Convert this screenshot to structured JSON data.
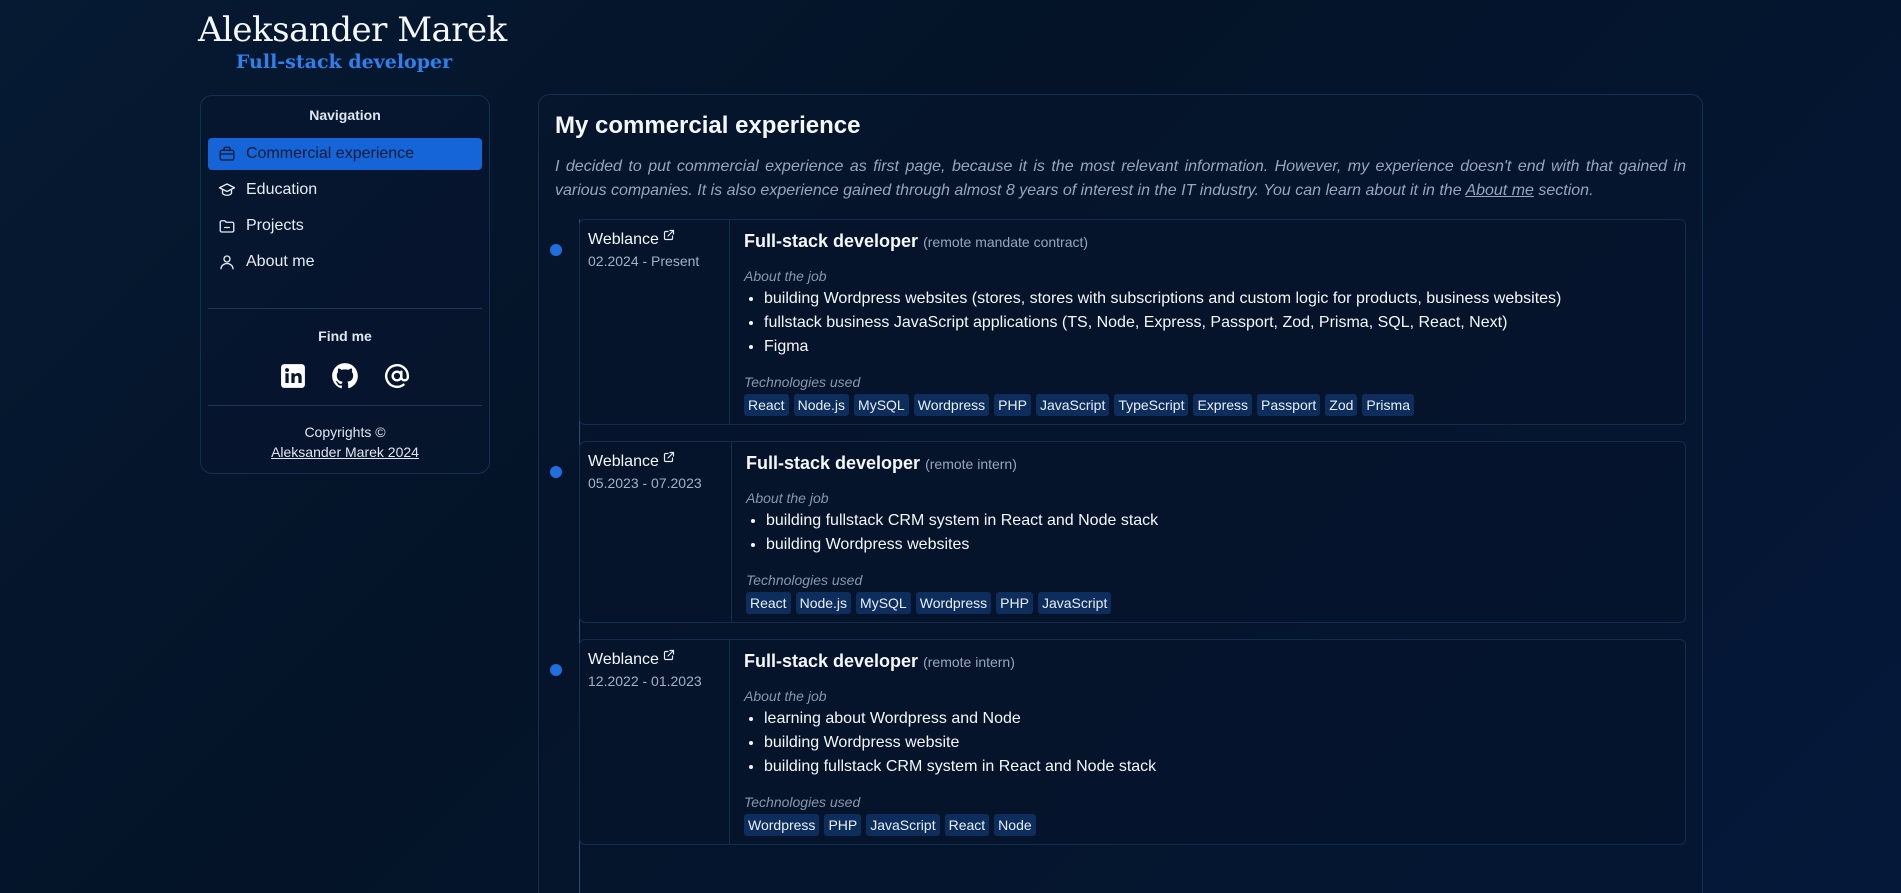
{
  "header": {
    "name": "Aleksander Marek",
    "role": "Full-stack developer"
  },
  "sidebar": {
    "nav_heading": "Navigation",
    "items": [
      {
        "label": "Commercial experience",
        "icon": "briefcase-icon",
        "active": true
      },
      {
        "label": "Education",
        "icon": "graduation-cap-icon",
        "active": false
      },
      {
        "label": "Projects",
        "icon": "folder-open-icon",
        "active": false
      },
      {
        "label": "About me",
        "icon": "user-icon",
        "active": false
      }
    ],
    "find_heading": "Find me",
    "social": [
      "linkedin-icon",
      "github-icon",
      "at-sign-icon"
    ],
    "copyright_line": "Copyrights ©",
    "copyright_link": "Aleksander Marek 2024"
  },
  "main": {
    "title": "My commercial experience",
    "intro_text": "I decided to put commercial experience as first page, because it is the most relevant information. However, my experience doesn't end with that gained in various companies. It is also experience gained through almost 8 years of interest in the IT industry. You can learn about it in the ",
    "intro_link": "About me",
    "intro_end": " section.",
    "about_label": "About the job",
    "tech_label": "Technologies used",
    "entries": [
      {
        "company": "Weblance",
        "dates": "02.2024 - Present",
        "title": "Full-stack developer",
        "type": "(remote mandate contract)",
        "duties": [
          "building Wordpress websites (stores, stores with subscriptions and custom logic for products, business websites)",
          "fullstack business JavaScript applications (TS, Node, Express, Passport, Zod, Prisma, SQL, React, Next)",
          "Figma"
        ],
        "tech": [
          "React",
          "Node.js",
          "MySQL",
          "Wordpress",
          "PHP",
          "JavaScript",
          "TypeScript",
          "Express",
          "Passport",
          "Zod",
          "Prisma"
        ]
      },
      {
        "company": "Weblance",
        "dates": "05.2023 - 07.2023",
        "title": "Full-stack developer",
        "type": "(remote intern)",
        "duties": [
          "building fullstack CRM system in React and Node stack",
          "building Wordpress websites"
        ],
        "tech": [
          "React",
          "Node.js",
          "MySQL",
          "Wordpress",
          "PHP",
          "JavaScript"
        ]
      },
      {
        "company": "Weblance",
        "dates": "12.2022 - 01.2023",
        "title": "Full-stack developer",
        "type": "(remote intern)",
        "duties": [
          "learning about Wordpress and Node",
          "building Wordpress website",
          "building fullstack CRM system in React and Node stack"
        ],
        "tech": [
          "Wordpress",
          "PHP",
          "JavaScript",
          "React",
          "Node"
        ]
      }
    ]
  },
  "colors": {
    "accent": "#1565d8",
    "brand_role": "#2f80ed",
    "tag_bg": "#0d2e5c",
    "background": "#04152e"
  }
}
